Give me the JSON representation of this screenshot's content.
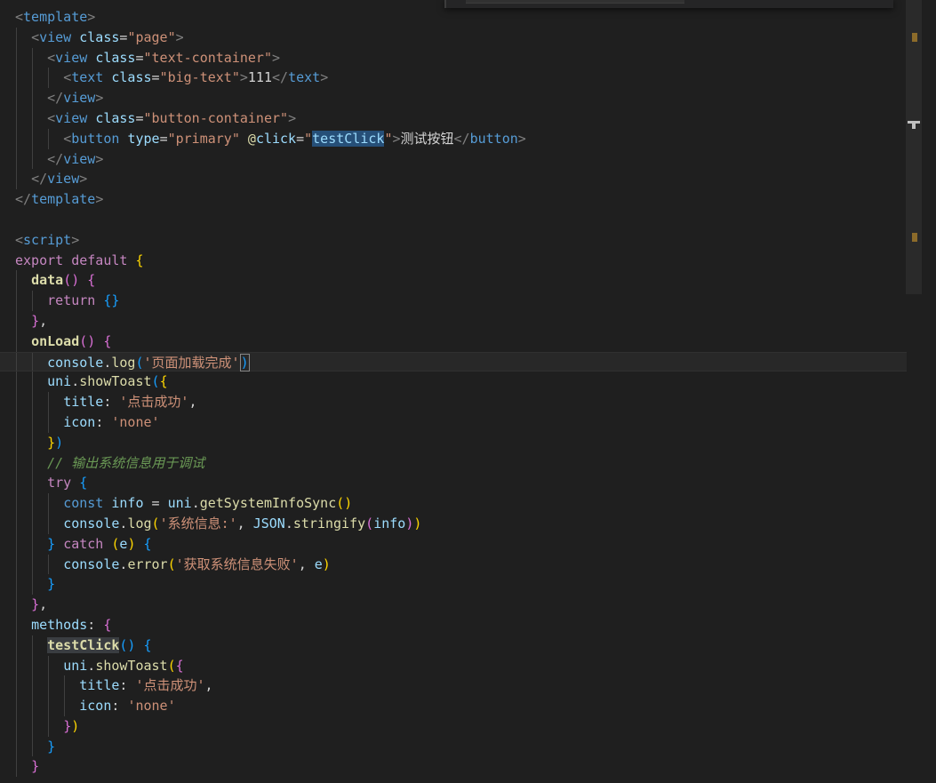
{
  "editor": {
    "language": "vue",
    "lines": [
      [
        [
          "t-punc",
          "<"
        ],
        [
          "t-tag",
          "template"
        ],
        [
          "t-punc",
          ">"
        ]
      ],
      [
        [
          "t-plain",
          "  "
        ],
        [
          "t-punc",
          "<"
        ],
        [
          "t-tag",
          "view"
        ],
        [
          "t-plain",
          " "
        ],
        [
          "t-attr",
          "class"
        ],
        [
          "t-plain",
          "="
        ],
        [
          "t-str",
          "\"page\""
        ],
        [
          "t-punc",
          ">"
        ]
      ],
      [
        [
          "t-plain",
          "    "
        ],
        [
          "t-punc",
          "<"
        ],
        [
          "t-tag",
          "view"
        ],
        [
          "t-plain",
          " "
        ],
        [
          "t-attr",
          "class"
        ],
        [
          "t-plain",
          "="
        ],
        [
          "t-str",
          "\"text-container\""
        ],
        [
          "t-punc",
          ">"
        ]
      ],
      [
        [
          "t-plain",
          "      "
        ],
        [
          "t-punc",
          "<"
        ],
        [
          "t-tag",
          "text"
        ],
        [
          "t-plain",
          " "
        ],
        [
          "t-attr",
          "class"
        ],
        [
          "t-plain",
          "="
        ],
        [
          "t-str",
          "\"big-text\""
        ],
        [
          "t-punc",
          ">"
        ],
        [
          "t-text",
          "111"
        ],
        [
          "t-punc",
          "</"
        ],
        [
          "t-tag",
          "text"
        ],
        [
          "t-punc",
          ">"
        ]
      ],
      [
        [
          "t-plain",
          "    "
        ],
        [
          "t-punc",
          "</"
        ],
        [
          "t-tag",
          "view"
        ],
        [
          "t-punc",
          ">"
        ]
      ],
      [
        [
          "t-plain",
          "    "
        ],
        [
          "t-punc",
          "<"
        ],
        [
          "t-tag",
          "view"
        ],
        [
          "t-plain",
          " "
        ],
        [
          "t-attr",
          "class"
        ],
        [
          "t-plain",
          "="
        ],
        [
          "t-str",
          "\"button-container\""
        ],
        [
          "t-punc",
          ">"
        ]
      ],
      [
        [
          "t-plain",
          "      "
        ],
        [
          "t-punc",
          "<"
        ],
        [
          "t-tag",
          "button"
        ],
        [
          "t-plain",
          " "
        ],
        [
          "t-attr",
          "type"
        ],
        [
          "t-plain",
          "="
        ],
        [
          "t-str",
          "\"primary\""
        ],
        [
          "t-plain",
          " "
        ],
        [
          "t-dir",
          "@"
        ],
        [
          "t-attr",
          "click"
        ],
        [
          "t-plain",
          "="
        ],
        [
          "t-str",
          "\""
        ],
        [
          "t-var hl",
          "testClick"
        ],
        [
          "t-str",
          "\""
        ],
        [
          "t-punc",
          ">"
        ],
        [
          "t-text",
          "测试按钮"
        ],
        [
          "t-punc",
          "</"
        ],
        [
          "t-tag",
          "button"
        ],
        [
          "t-punc",
          ">"
        ]
      ],
      [
        [
          "t-plain",
          "    "
        ],
        [
          "t-punc",
          "</"
        ],
        [
          "t-tag",
          "view"
        ],
        [
          "t-punc",
          ">"
        ]
      ],
      [
        [
          "t-plain",
          "  "
        ],
        [
          "t-punc",
          "</"
        ],
        [
          "t-tag",
          "view"
        ],
        [
          "t-punc",
          ">"
        ]
      ],
      [
        [
          "t-punc",
          "</"
        ],
        [
          "t-tag",
          "template"
        ],
        [
          "t-punc",
          ">"
        ]
      ],
      [],
      [
        [
          "t-punc",
          "<"
        ],
        [
          "t-tag",
          "script"
        ],
        [
          "t-punc",
          ">"
        ]
      ],
      [
        [
          "t-kw",
          "export"
        ],
        [
          "t-plain",
          " "
        ],
        [
          "t-kw",
          "default"
        ],
        [
          "t-plain",
          " "
        ],
        [
          "t-b1",
          "{"
        ]
      ],
      [
        [
          "t-plain",
          "  "
        ],
        [
          "t-method",
          "data"
        ],
        [
          "t-b2",
          "()"
        ],
        [
          "t-plain",
          " "
        ],
        [
          "t-b2",
          "{"
        ]
      ],
      [
        [
          "t-plain",
          "    "
        ],
        [
          "t-kw",
          "return"
        ],
        [
          "t-plain",
          " "
        ],
        [
          "t-b3",
          "{}"
        ]
      ],
      [
        [
          "t-plain",
          "  "
        ],
        [
          "t-b2",
          "}"
        ],
        [
          "t-plain",
          ","
        ]
      ],
      [
        [
          "t-plain",
          "  "
        ],
        [
          "t-method",
          "onLoad"
        ],
        [
          "t-b2",
          "()"
        ],
        [
          "t-plain",
          " "
        ],
        [
          "t-b2",
          "{"
        ]
      ],
      [
        [
          "t-plain",
          "    "
        ],
        [
          "t-var",
          "console"
        ],
        [
          "t-plain",
          "."
        ],
        [
          "t-fn",
          "log"
        ],
        [
          "t-b3",
          "("
        ],
        [
          "t-str",
          "'页面加载完成'"
        ],
        [
          "t-b3 cursor-box",
          ")"
        ]
      ],
      [
        [
          "t-plain",
          "    "
        ],
        [
          "t-var",
          "uni"
        ],
        [
          "t-plain",
          "."
        ],
        [
          "t-fn",
          "showToast"
        ],
        [
          "t-b3",
          "("
        ],
        [
          "t-b1",
          "{"
        ]
      ],
      [
        [
          "t-plain",
          "      "
        ],
        [
          "t-var",
          "title"
        ],
        [
          "t-plain",
          ": "
        ],
        [
          "t-str",
          "'点击成功'"
        ],
        [
          "t-plain",
          ","
        ]
      ],
      [
        [
          "t-plain",
          "      "
        ],
        [
          "t-var",
          "icon"
        ],
        [
          "t-plain",
          ": "
        ],
        [
          "t-str",
          "'none'"
        ]
      ],
      [
        [
          "t-plain",
          "    "
        ],
        [
          "t-b1",
          "}"
        ],
        [
          "t-b3",
          ")"
        ]
      ],
      [
        [
          "t-plain",
          "    "
        ],
        [
          "t-cmt",
          "// 输出系统信息用于调试"
        ]
      ],
      [
        [
          "t-plain",
          "    "
        ],
        [
          "t-kw",
          "try"
        ],
        [
          "t-plain",
          " "
        ],
        [
          "t-b3",
          "{"
        ]
      ],
      [
        [
          "t-plain",
          "      "
        ],
        [
          "t-blue",
          "const"
        ],
        [
          "t-plain",
          " "
        ],
        [
          "t-var",
          "info"
        ],
        [
          "t-plain",
          " = "
        ],
        [
          "t-var",
          "uni"
        ],
        [
          "t-plain",
          "."
        ],
        [
          "t-fn",
          "getSystemInfoSync"
        ],
        [
          "t-b1",
          "()"
        ]
      ],
      [
        [
          "t-plain",
          "      "
        ],
        [
          "t-var",
          "console"
        ],
        [
          "t-plain",
          "."
        ],
        [
          "t-fn",
          "log"
        ],
        [
          "t-b1",
          "("
        ],
        [
          "t-str",
          "'系统信息:'"
        ],
        [
          "t-plain",
          ", "
        ],
        [
          "t-var",
          "JSON"
        ],
        [
          "t-plain",
          "."
        ],
        [
          "t-fn",
          "stringify"
        ],
        [
          "t-b2",
          "("
        ],
        [
          "t-var",
          "info"
        ],
        [
          "t-b2",
          ")"
        ],
        [
          "t-b1",
          ")"
        ]
      ],
      [
        [
          "t-plain",
          "    "
        ],
        [
          "t-b3",
          "}"
        ],
        [
          "t-plain",
          " "
        ],
        [
          "t-kw",
          "catch"
        ],
        [
          "t-plain",
          " "
        ],
        [
          "t-b1",
          "("
        ],
        [
          "t-var",
          "e"
        ],
        [
          "t-b1",
          ")"
        ],
        [
          "t-plain",
          " "
        ],
        [
          "t-b3",
          "{"
        ]
      ],
      [
        [
          "t-plain",
          "      "
        ],
        [
          "t-var",
          "console"
        ],
        [
          "t-plain",
          "."
        ],
        [
          "t-fn",
          "error"
        ],
        [
          "t-b1",
          "("
        ],
        [
          "t-str",
          "'获取系统信息失败'"
        ],
        [
          "t-plain",
          ", "
        ],
        [
          "t-var",
          "e"
        ],
        [
          "t-b1",
          ")"
        ]
      ],
      [
        [
          "t-plain",
          "    "
        ],
        [
          "t-b3",
          "}"
        ]
      ],
      [
        [
          "t-plain",
          "  "
        ],
        [
          "t-b2",
          "}"
        ],
        [
          "t-plain",
          ","
        ]
      ],
      [
        [
          "t-plain",
          "  "
        ],
        [
          "t-var",
          "methods"
        ],
        [
          "t-plain",
          ": "
        ],
        [
          "t-b2",
          "{"
        ]
      ],
      [
        [
          "t-plain",
          "    "
        ],
        [
          "t-method hl-fn",
          "testClick"
        ],
        [
          "t-b3",
          "()"
        ],
        [
          "t-plain",
          " "
        ],
        [
          "t-b3",
          "{"
        ]
      ],
      [
        [
          "t-plain",
          "      "
        ],
        [
          "t-var",
          "uni"
        ],
        [
          "t-plain",
          "."
        ],
        [
          "t-fn",
          "showToast"
        ],
        [
          "t-b1",
          "("
        ],
        [
          "t-b2",
          "{"
        ]
      ],
      [
        [
          "t-plain",
          "        "
        ],
        [
          "t-var",
          "title"
        ],
        [
          "t-plain",
          ": "
        ],
        [
          "t-str",
          "'点击成功'"
        ],
        [
          "t-plain",
          ","
        ]
      ],
      [
        [
          "t-plain",
          "        "
        ],
        [
          "t-var",
          "icon"
        ],
        [
          "t-plain",
          ": "
        ],
        [
          "t-str",
          "'none'"
        ]
      ],
      [
        [
          "t-plain",
          "      "
        ],
        [
          "t-b2",
          "}"
        ],
        [
          "t-b1",
          ")"
        ]
      ],
      [
        [
          "t-plain",
          "    "
        ],
        [
          "t-b3",
          "}"
        ]
      ],
      [
        [
          "t-plain",
          "  "
        ],
        [
          "t-b2",
          "}"
        ]
      ]
    ],
    "current_line": 17,
    "guides": [
      [],
      [
        1
      ],
      [
        1,
        2
      ],
      [
        1,
        2,
        3
      ],
      [
        1,
        2
      ],
      [
        1,
        2
      ],
      [
        1,
        2,
        3
      ],
      [
        1,
        2
      ],
      [
        1
      ],
      [],
      [],
      [],
      [],
      [
        1
      ],
      [
        1,
        2
      ],
      [
        1
      ],
      [
        1
      ],
      [
        1,
        2
      ],
      [
        1,
        2
      ],
      [
        1,
        2,
        3
      ],
      [
        1,
        2,
        3
      ],
      [
        1,
        2
      ],
      [
        1,
        2
      ],
      [
        1,
        2
      ],
      [
        1,
        2,
        3
      ],
      [
        1,
        2,
        3
      ],
      [
        1,
        2
      ],
      [
        1,
        2,
        3
      ],
      [
        1,
        2
      ],
      [
        1
      ],
      [
        1
      ],
      [
        1,
        2
      ],
      [
        1,
        2,
        3
      ],
      [
        1,
        2,
        3,
        4
      ],
      [
        1,
        2,
        3,
        4
      ],
      [
        1,
        2,
        3
      ],
      [
        1,
        2
      ],
      [
        1
      ]
    ]
  }
}
